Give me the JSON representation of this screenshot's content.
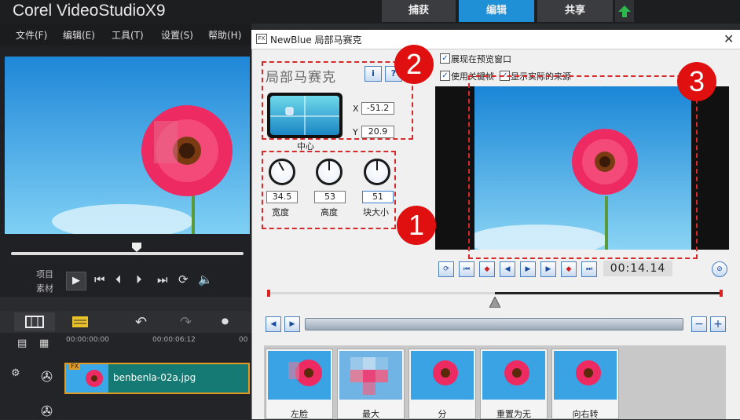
{
  "app": {
    "logo": "Corel VideoStudioX9",
    "tabs": [
      "捕获",
      "编辑",
      "共享"
    ],
    "active_tab": "编辑",
    "menu": [
      "文件(F)",
      "编辑(E)",
      "工具(T)",
      "设置(S)",
      "帮助(H)"
    ]
  },
  "player": {
    "mode_project": "项目",
    "mode_clip": "素材"
  },
  "timeline": {
    "times": [
      "00:00:00:00",
      "00:00:06:12",
      "00"
    ],
    "clip_name": "benbenla-02a.jpg",
    "fx_badge": "FX"
  },
  "dialog": {
    "title": "NewBlue 局部马赛克",
    "icon": "FX",
    "plugin_name": "局部马赛克",
    "info_button": "i",
    "help_button": "?",
    "center_label": "中心",
    "x_label": "X",
    "x_value": "-51.2",
    "y_label": "Y",
    "y_value": "20.9",
    "knobs": [
      {
        "label": "宽度",
        "value": "34.5"
      },
      {
        "label": "高度",
        "value": "53"
      },
      {
        "label": "块大小",
        "value": "51"
      }
    ],
    "checkboxes": [
      {
        "label": "展现在预览窗口",
        "checked": true
      },
      {
        "label": "使用关键帧",
        "checked": true
      },
      {
        "label": "显示实际的来源",
        "checked": true
      }
    ],
    "timecode": "00:14.14",
    "presets": [
      "左脸",
      "最大",
      "分",
      "重置为无",
      "向右转"
    ]
  },
  "annotations": [
    "1",
    "2",
    "3"
  ],
  "colors": {
    "active_tab": "#1f8fd6",
    "annotation_red": "#e01010",
    "clip_green": "#157a73",
    "clip_border": "#e39a23"
  }
}
